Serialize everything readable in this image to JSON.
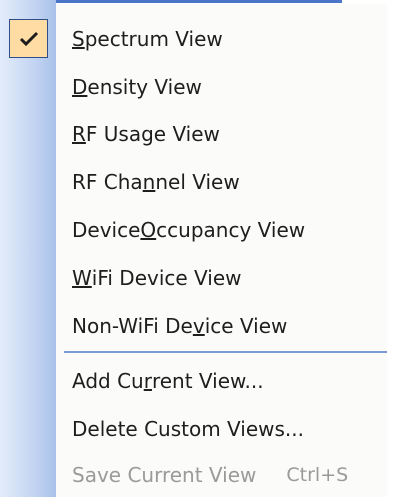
{
  "menu": {
    "items": [
      {
        "id": "spectrum-view",
        "label": "Spectrum View",
        "mnemonic": "S",
        "checked": true
      },
      {
        "id": "density-view",
        "label": "Density View",
        "mnemonic": "D"
      },
      {
        "id": "rf-usage-view",
        "label": "RF Usage View",
        "mnemonic": "R"
      },
      {
        "id": "rf-channel-view",
        "label": "RF Channel View",
        "mnemonic": "n"
      },
      {
        "id": "device-occupancy-view",
        "label": "Device Occupancy View",
        "mnemonic": "O"
      },
      {
        "id": "wifi-device-view",
        "label": "WiFi Device View",
        "mnemonic": "W"
      },
      {
        "id": "non-wifi-device-view",
        "label": "Non-WiFi Device View",
        "mnemonic": "v"
      }
    ],
    "actions": [
      {
        "id": "add-current-view",
        "label": "Add Current View...",
        "mnemonic": "r"
      },
      {
        "id": "delete-custom-views",
        "label": "Delete Custom Views..."
      },
      {
        "id": "save-current-view",
        "label": "Save Current View",
        "shortcut": "Ctrl+S",
        "disabled": true
      }
    ]
  },
  "colors": {
    "gutter": "#c4d5f2",
    "check_highlight": "#ffdca3",
    "check_mark": "#1c1c1c",
    "separator": "#7a9bd6",
    "disabled_text": "#9a9a9a"
  }
}
